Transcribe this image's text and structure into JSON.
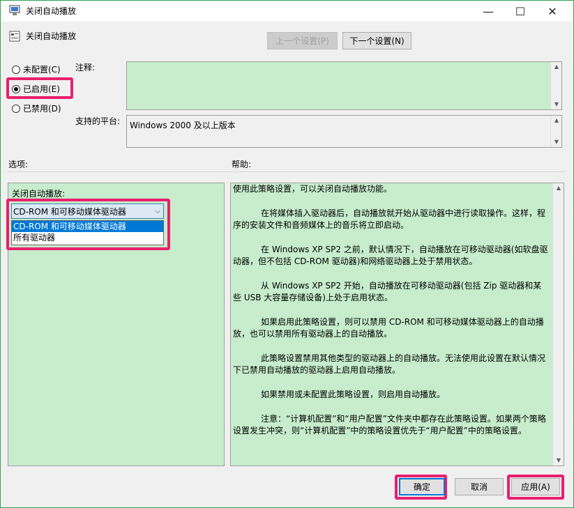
{
  "window": {
    "title": "关闭自动播放",
    "minimize_glyph": "—",
    "maximize_glyph": "☐",
    "close_glyph": "✕"
  },
  "policy": {
    "name": "关闭自动播放",
    "prev_button": "上一个设置(P)",
    "next_button": "下一个设置(N)"
  },
  "state": {
    "not_configured": "未配置(C)",
    "enabled": "已启用(E)",
    "disabled": "已禁用(D)",
    "selected": "enabled"
  },
  "comment": {
    "label": "注释:",
    "value": ""
  },
  "platform": {
    "label": "支持的平台:",
    "value": "Windows 2000 及以上版本"
  },
  "options": {
    "label": "选项:",
    "field_label": "关闭自动播放:",
    "selected_value": "CD-ROM 和可移动媒体驱动器",
    "dropdown_items": [
      "CD-ROM 和可移动媒体驱动器",
      "所有驱动器"
    ]
  },
  "help": {
    "label": "帮助:",
    "paragraphs": [
      "使用此策略设置，可以关闭自动播放功能。",
      "在将媒体插入驱动器后，自动播放就开始从驱动器中进行读取操作。这样，程序的安装文件和音频媒体上的音乐将立即启动。",
      "在 Windows XP SP2 之前，默认情况下，自动播放在可移动驱动器(如软盘驱动器，但不包括 CD-ROM 驱动器)和网络驱动器上处于禁用状态。",
      "从 Windows XP SP2 开始，自动播放在可移动驱动器(包括 Zip 驱动器和某些 USB 大容量存储设备)上处于启用状态。",
      "如果启用此策略设置，则可以禁用 CD-ROM 和可移动媒体驱动器上的自动播放，也可以禁用所有驱动器上的自动播放。",
      "此策略设置禁用其他类型的驱动器上的自动播放。无法使用此设置在默认情况下已禁用自动播放的驱动器上启用自动播放。",
      "如果禁用或未配置此策略设置，则启用自动播放。",
      "注意：“计算机配置”和“用户配置”文件夹中都存在此策略设置。如果两个策略设置发生冲突，则“计算机配置”中的策略设置优先于“用户配置”中的策略设置。"
    ]
  },
  "footer": {
    "ok": "确定",
    "cancel": "取消",
    "apply": "应用(A)"
  },
  "colors": {
    "accent": "#2da44e",
    "highlight": "#e8206e",
    "panel_green": "#c7edcc",
    "selection": "#0078d7"
  }
}
